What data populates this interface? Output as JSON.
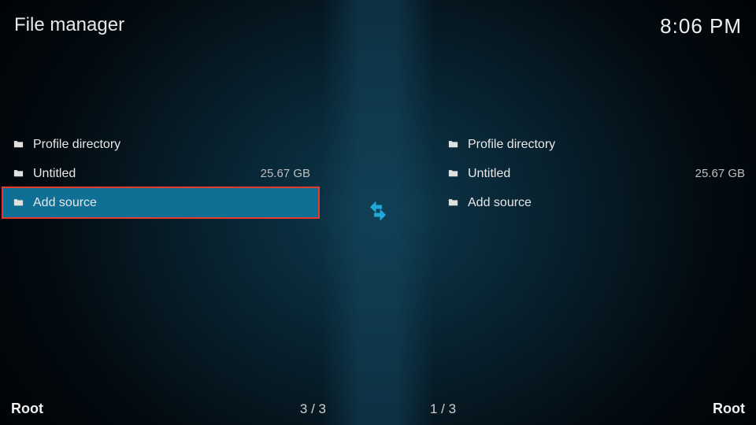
{
  "header": {
    "title": "File manager",
    "clock": "8:06 PM"
  },
  "icons": {
    "folder": "folder-icon",
    "transfer": "transfer-arrows-icon"
  },
  "left_pane": {
    "items": [
      {
        "label": "Profile directory",
        "meta": ""
      },
      {
        "label": "Untitled",
        "meta": "25.67 GB"
      },
      {
        "label": "Add source",
        "meta": ""
      }
    ],
    "selected_index": 2,
    "status_label": "Root",
    "status_count": "3 / 3"
  },
  "right_pane": {
    "items": [
      {
        "label": "Profile directory",
        "meta": ""
      },
      {
        "label": "Untitled",
        "meta": "25.67 GB"
      },
      {
        "label": "Add source",
        "meta": ""
      }
    ],
    "selected_index": null,
    "status_label": "Root",
    "status_count": "1 / 3"
  },
  "annotation": {
    "pane": "left",
    "index": 2
  },
  "colors": {
    "accent": "#1fa8d8",
    "highlight_bg": "#0f6f95",
    "annotation_outline": "#e53b2e"
  }
}
